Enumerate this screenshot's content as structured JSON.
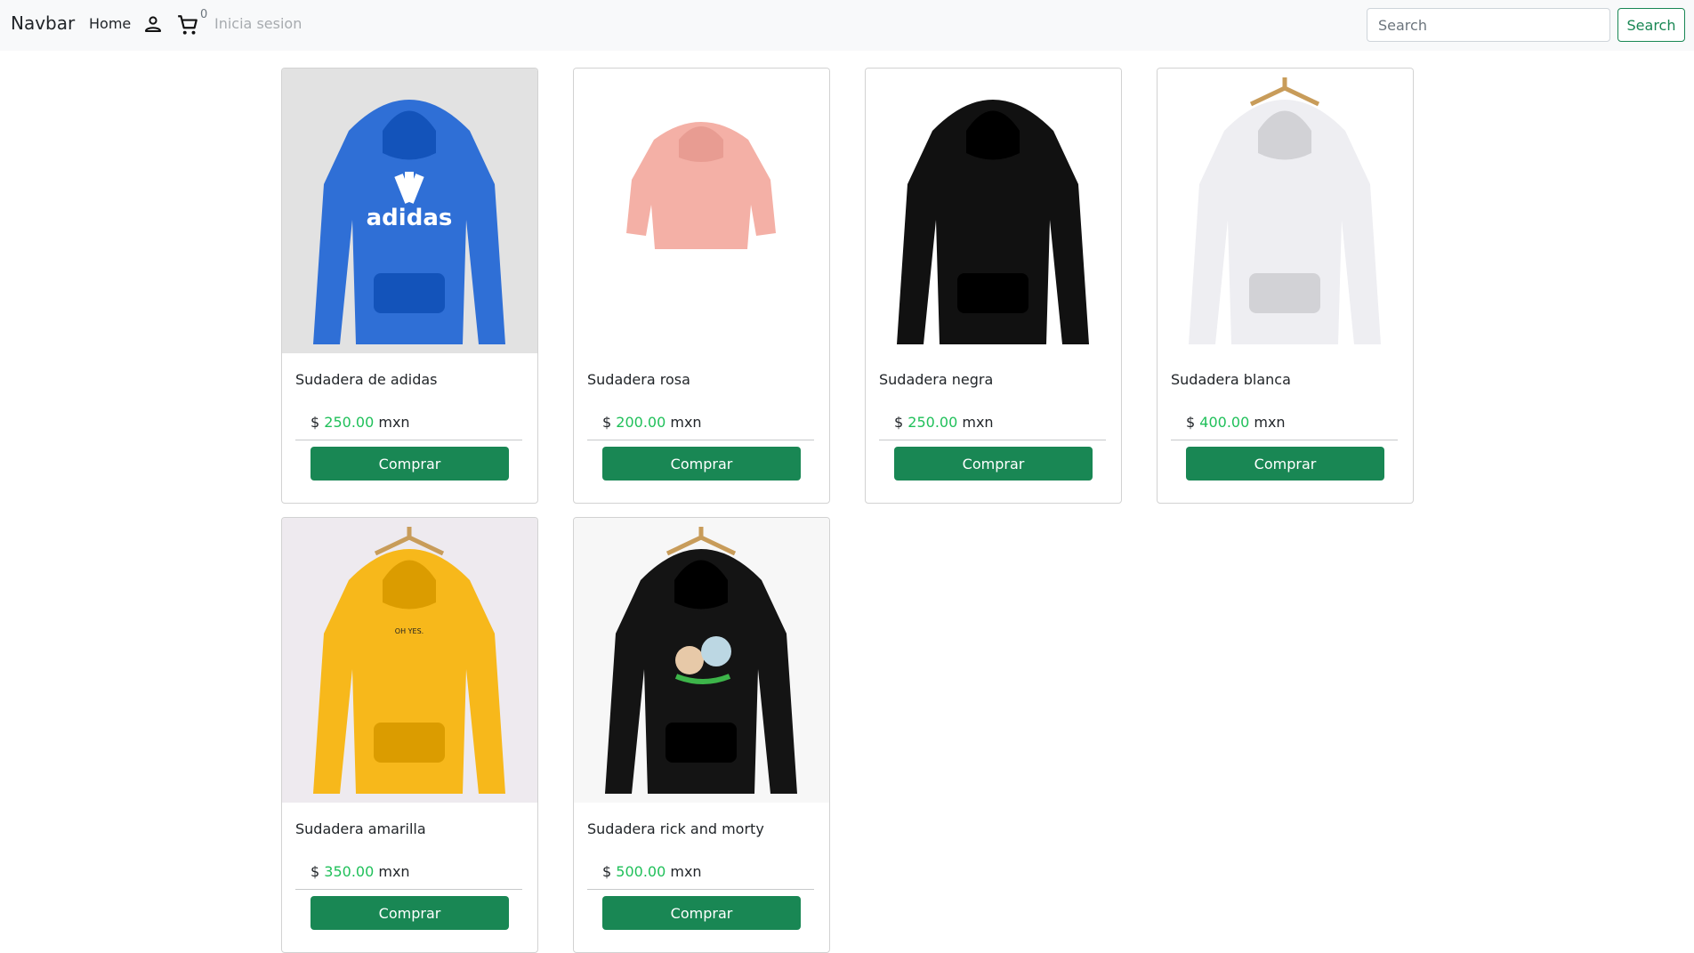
{
  "navbar": {
    "brand": "Navbar",
    "home": "Home",
    "user_icon": "person-icon",
    "cart_icon": "cart-icon",
    "cart_count": "0",
    "login": "Inicia sesion",
    "search_placeholder": "Search",
    "search_button": "Search"
  },
  "colors": {
    "accent": "#198754",
    "price": "#20c05a",
    "navbar_bg": "#f8f9fa"
  },
  "products": [
    {
      "title": "Sudadera de adidas",
      "currency": "$",
      "price": "250.00",
      "unit": "mxn",
      "button": "Comprar",
      "color": "#2f6fd6",
      "logo": "adidas"
    },
    {
      "title": "Sudadera rosa",
      "currency": "$",
      "price": "200.00",
      "unit": "mxn",
      "button": "Comprar",
      "color": "#f4b0a6"
    },
    {
      "title": "Sudadera negra",
      "currency": "$",
      "price": "250.00",
      "unit": "mxn",
      "button": "Comprar",
      "color": "#111111"
    },
    {
      "title": "Sudadera blanca",
      "currency": "$",
      "price": "400.00",
      "unit": "mxn",
      "button": "Comprar",
      "color": "#eeeef2"
    },
    {
      "title": "Sudadera amarilla",
      "currency": "$",
      "price": "350.00",
      "unit": "mxn",
      "button": "Comprar",
      "color": "#f7b81b",
      "logo": "OH YES"
    },
    {
      "title": "Sudadera rick and morty",
      "currency": "$",
      "price": "500.00",
      "unit": "mxn",
      "button": "Comprar",
      "color": "#141414"
    }
  ]
}
